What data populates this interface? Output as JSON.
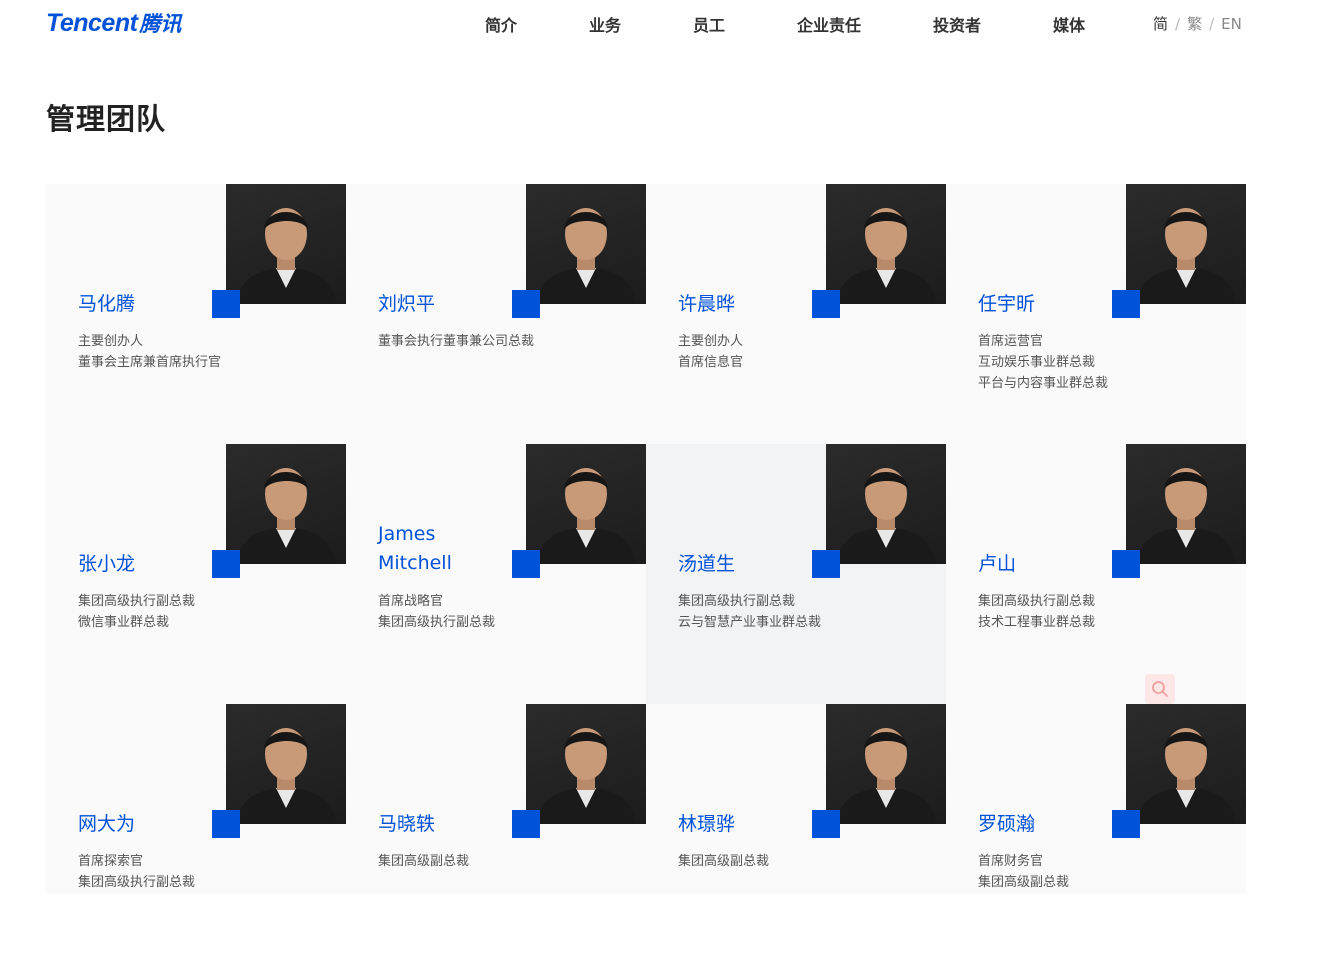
{
  "header": {
    "logo_en": "Tencent",
    "logo_cn": "腾讯",
    "nav": [
      "简介",
      "业务",
      "员工",
      "企业责任",
      "投资者",
      "媒体"
    ],
    "lang": {
      "simplified": "简",
      "traditional": "繁",
      "english": "EN",
      "separator": "/"
    }
  },
  "page": {
    "title": "管理团队"
  },
  "colors": {
    "accent": "#0052d9",
    "card_bg": "#fafafa",
    "card_hover_bg": "#f2f3f5",
    "photo_bg": "#252525"
  },
  "team": [
    {
      "name": "马化腾",
      "roles": [
        "主要创办人",
        "董事会主席兼首席执行官"
      ]
    },
    {
      "name": "刘炽平",
      "roles": [
        "董事会执行董事兼公司总裁"
      ]
    },
    {
      "name": "许晨晔",
      "roles": [
        "主要创办人",
        "首席信息官"
      ]
    },
    {
      "name": "任宇昕",
      "roles": [
        "首席运营官",
        "互动娱乐事业群总裁",
        "平台与内容事业群总裁"
      ]
    },
    {
      "name": "张小龙",
      "roles": [
        "集团高级执行副总裁",
        "微信事业群总裁"
      ]
    },
    {
      "name": "James Mitchell",
      "name_lines": [
        "James",
        "Mitchell"
      ],
      "roles": [
        "首席战略官",
        "集团高级执行副总裁"
      ]
    },
    {
      "name": "汤道生",
      "roles": [
        "集团高级执行副总裁",
        "云与智慧产业事业群总裁"
      ]
    },
    {
      "name": "卢山",
      "roles": [
        "集团高级执行副总裁",
        "技术工程事业群总裁"
      ]
    },
    {
      "name": "网大为",
      "roles": [
        "首席探索官",
        "集团高级执行副总裁"
      ]
    },
    {
      "name": "马晓轶",
      "roles": [
        "集团高级副总裁"
      ]
    },
    {
      "name": "林璟骅",
      "roles": [
        "集团高级副总裁"
      ]
    },
    {
      "name": "罗硕瀚",
      "roles": [
        "首席财务官",
        "集团高级副总裁"
      ]
    }
  ],
  "icons": {
    "portrait": "person-silhouette-icon",
    "search": "search-icon"
  }
}
